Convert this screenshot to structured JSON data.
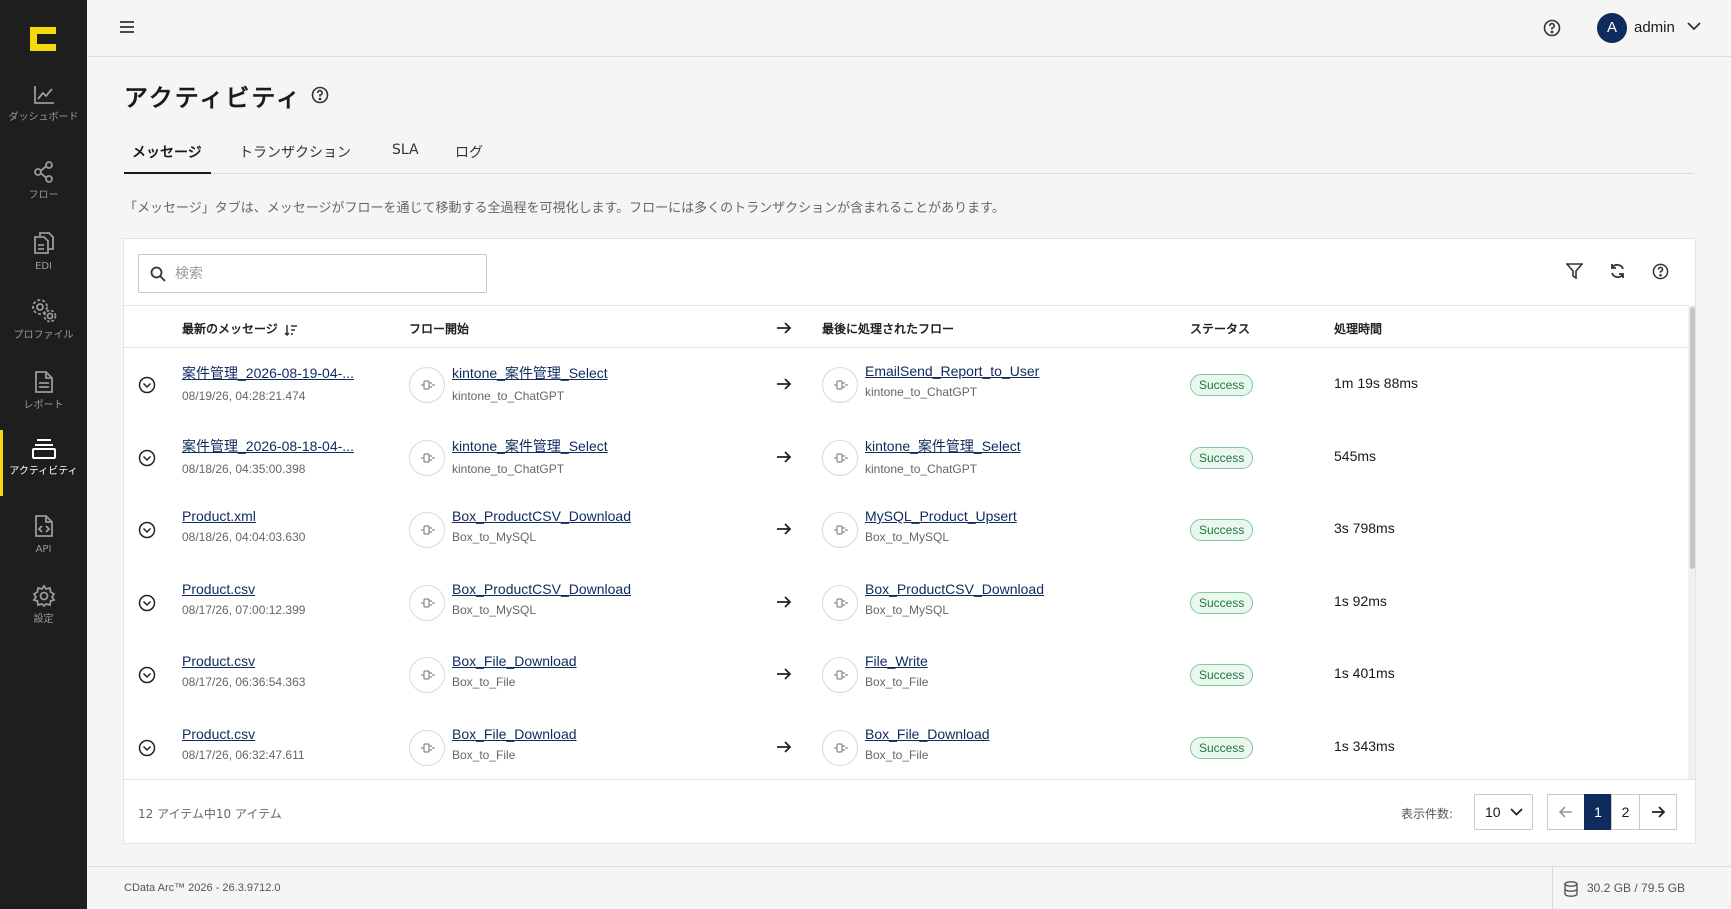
{
  "sidebar": {
    "items": [
      {
        "label": "ダッシュボード",
        "icon": "chart-line-icon"
      },
      {
        "label": "フロー",
        "icon": "share-nodes-icon"
      },
      {
        "label": "EDI",
        "icon": "documents-icon"
      },
      {
        "label": "プロファイル",
        "icon": "gears-icon"
      },
      {
        "label": "レポート",
        "icon": "report-icon"
      },
      {
        "label": "アクティビティ",
        "icon": "layers-icon"
      },
      {
        "label": "API",
        "icon": "api-file-icon"
      },
      {
        "label": "設定",
        "icon": "gear-icon"
      }
    ],
    "active": "アクティビティ"
  },
  "header": {
    "user_initial": "A",
    "user_name": "admin"
  },
  "page": {
    "title": "アクティビティ",
    "tabs": [
      "メッセージ",
      "トランザクション",
      "SLA",
      "ログ"
    ],
    "active_tab": "メッセージ",
    "description": "「メッセージ」タブは、メッセージがフローを通じて移動する全過程を可視化します。フローには多くのトランザクションが含まれることがあります。"
  },
  "search": {
    "placeholder": "検索",
    "value": ""
  },
  "table": {
    "columns": {
      "latest": "最新のメッセージ",
      "flow_start": "フロー開始",
      "last_flow": "最後に処理されたフロー",
      "status": "ステータス",
      "duration": "処理時間"
    },
    "rows": [
      {
        "name": "案件管理_2026-08-19-04-...",
        "time": "08/19/26, 04:28:21.474",
        "start": "kintone_案件管理_Select",
        "start_sub": "kintone_to_ChatGPT",
        "last": "EmailSend_Report_to_User",
        "last_sub": "kintone_to_ChatGPT",
        "status": "Success",
        "duration": "1m 19s 88ms"
      },
      {
        "name": "案件管理_2026-08-18-04-...",
        "time": "08/18/26, 04:35:00.398",
        "start": "kintone_案件管理_Select",
        "start_sub": "kintone_to_ChatGPT",
        "last": "kintone_案件管理_Select",
        "last_sub": "kintone_to_ChatGPT",
        "status": "Success",
        "duration": "545ms"
      },
      {
        "name": "Product.xml",
        "time": "08/18/26, 04:04:03.630",
        "start": "Box_ProductCSV_Download",
        "start_sub": "Box_to_MySQL",
        "last": "MySQL_Product_Upsert",
        "last_sub": "Box_to_MySQL",
        "status": "Success",
        "duration": "3s 798ms"
      },
      {
        "name": "Product.csv",
        "time": "08/17/26, 07:00:12.399",
        "start": "Box_ProductCSV_Download",
        "start_sub": "Box_to_MySQL",
        "last": "Box_ProductCSV_Download",
        "last_sub": "Box_to_MySQL",
        "status": "Success",
        "duration": "1s 92ms"
      },
      {
        "name": "Product.csv",
        "time": "08/17/26, 06:36:54.363",
        "start": "Box_File_Download",
        "start_sub": "Box_to_File",
        "last": "File_Write",
        "last_sub": "Box_to_File",
        "status": "Success",
        "duration": "1s 401ms"
      },
      {
        "name": "Product.csv",
        "time": "08/17/26, 06:32:47.611",
        "start": "Box_File_Download",
        "start_sub": "Box_to_File",
        "last": "Box_File_Download",
        "last_sub": "Box_to_File",
        "status": "Success",
        "duration": "1s 343ms"
      }
    ]
  },
  "pagination": {
    "count_text": "12 アイテム中10 アイテム",
    "page_size_label": "表示件数:",
    "page_size": "10",
    "pages": [
      "1",
      "2"
    ],
    "current_page": "1"
  },
  "footer": {
    "version": "CData Arc™ 2026 - 26.3.9712.0",
    "storage": "30.2 GB / 79.5 GB"
  },
  "colors": {
    "sidebar_bg": "#1e1e1e",
    "accent": "#f5d90a",
    "primary": "#0f2a5c",
    "success": "#1e7a40"
  }
}
